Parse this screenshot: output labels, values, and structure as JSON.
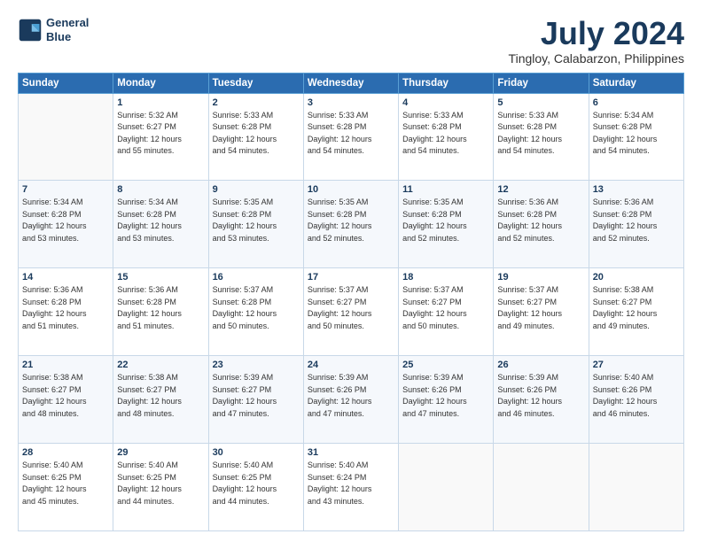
{
  "header": {
    "logo_line1": "General",
    "logo_line2": "Blue",
    "title": "July 2024",
    "subtitle": "Tingloy, Calabarzon, Philippines"
  },
  "columns": [
    "Sunday",
    "Monday",
    "Tuesday",
    "Wednesday",
    "Thursday",
    "Friday",
    "Saturday"
  ],
  "weeks": [
    [
      {
        "num": "",
        "info": ""
      },
      {
        "num": "1",
        "info": "Sunrise: 5:32 AM\nSunset: 6:27 PM\nDaylight: 12 hours\nand 55 minutes."
      },
      {
        "num": "2",
        "info": "Sunrise: 5:33 AM\nSunset: 6:28 PM\nDaylight: 12 hours\nand 54 minutes."
      },
      {
        "num": "3",
        "info": "Sunrise: 5:33 AM\nSunset: 6:28 PM\nDaylight: 12 hours\nand 54 minutes."
      },
      {
        "num": "4",
        "info": "Sunrise: 5:33 AM\nSunset: 6:28 PM\nDaylight: 12 hours\nand 54 minutes."
      },
      {
        "num": "5",
        "info": "Sunrise: 5:33 AM\nSunset: 6:28 PM\nDaylight: 12 hours\nand 54 minutes."
      },
      {
        "num": "6",
        "info": "Sunrise: 5:34 AM\nSunset: 6:28 PM\nDaylight: 12 hours\nand 54 minutes."
      }
    ],
    [
      {
        "num": "7",
        "info": "Sunrise: 5:34 AM\nSunset: 6:28 PM\nDaylight: 12 hours\nand 53 minutes."
      },
      {
        "num": "8",
        "info": "Sunrise: 5:34 AM\nSunset: 6:28 PM\nDaylight: 12 hours\nand 53 minutes."
      },
      {
        "num": "9",
        "info": "Sunrise: 5:35 AM\nSunset: 6:28 PM\nDaylight: 12 hours\nand 53 minutes."
      },
      {
        "num": "10",
        "info": "Sunrise: 5:35 AM\nSunset: 6:28 PM\nDaylight: 12 hours\nand 52 minutes."
      },
      {
        "num": "11",
        "info": "Sunrise: 5:35 AM\nSunset: 6:28 PM\nDaylight: 12 hours\nand 52 minutes."
      },
      {
        "num": "12",
        "info": "Sunrise: 5:36 AM\nSunset: 6:28 PM\nDaylight: 12 hours\nand 52 minutes."
      },
      {
        "num": "13",
        "info": "Sunrise: 5:36 AM\nSunset: 6:28 PM\nDaylight: 12 hours\nand 52 minutes."
      }
    ],
    [
      {
        "num": "14",
        "info": "Sunrise: 5:36 AM\nSunset: 6:28 PM\nDaylight: 12 hours\nand 51 minutes."
      },
      {
        "num": "15",
        "info": "Sunrise: 5:36 AM\nSunset: 6:28 PM\nDaylight: 12 hours\nand 51 minutes."
      },
      {
        "num": "16",
        "info": "Sunrise: 5:37 AM\nSunset: 6:28 PM\nDaylight: 12 hours\nand 50 minutes."
      },
      {
        "num": "17",
        "info": "Sunrise: 5:37 AM\nSunset: 6:27 PM\nDaylight: 12 hours\nand 50 minutes."
      },
      {
        "num": "18",
        "info": "Sunrise: 5:37 AM\nSunset: 6:27 PM\nDaylight: 12 hours\nand 50 minutes."
      },
      {
        "num": "19",
        "info": "Sunrise: 5:37 AM\nSunset: 6:27 PM\nDaylight: 12 hours\nand 49 minutes."
      },
      {
        "num": "20",
        "info": "Sunrise: 5:38 AM\nSunset: 6:27 PM\nDaylight: 12 hours\nand 49 minutes."
      }
    ],
    [
      {
        "num": "21",
        "info": "Sunrise: 5:38 AM\nSunset: 6:27 PM\nDaylight: 12 hours\nand 48 minutes."
      },
      {
        "num": "22",
        "info": "Sunrise: 5:38 AM\nSunset: 6:27 PM\nDaylight: 12 hours\nand 48 minutes."
      },
      {
        "num": "23",
        "info": "Sunrise: 5:39 AM\nSunset: 6:27 PM\nDaylight: 12 hours\nand 47 minutes."
      },
      {
        "num": "24",
        "info": "Sunrise: 5:39 AM\nSunset: 6:26 PM\nDaylight: 12 hours\nand 47 minutes."
      },
      {
        "num": "25",
        "info": "Sunrise: 5:39 AM\nSunset: 6:26 PM\nDaylight: 12 hours\nand 47 minutes."
      },
      {
        "num": "26",
        "info": "Sunrise: 5:39 AM\nSunset: 6:26 PM\nDaylight: 12 hours\nand 46 minutes."
      },
      {
        "num": "27",
        "info": "Sunrise: 5:40 AM\nSunset: 6:26 PM\nDaylight: 12 hours\nand 46 minutes."
      }
    ],
    [
      {
        "num": "28",
        "info": "Sunrise: 5:40 AM\nSunset: 6:25 PM\nDaylight: 12 hours\nand 45 minutes."
      },
      {
        "num": "29",
        "info": "Sunrise: 5:40 AM\nSunset: 6:25 PM\nDaylight: 12 hours\nand 44 minutes."
      },
      {
        "num": "30",
        "info": "Sunrise: 5:40 AM\nSunset: 6:25 PM\nDaylight: 12 hours\nand 44 minutes."
      },
      {
        "num": "31",
        "info": "Sunrise: 5:40 AM\nSunset: 6:24 PM\nDaylight: 12 hours\nand 43 minutes."
      },
      {
        "num": "",
        "info": ""
      },
      {
        "num": "",
        "info": ""
      },
      {
        "num": "",
        "info": ""
      }
    ]
  ]
}
